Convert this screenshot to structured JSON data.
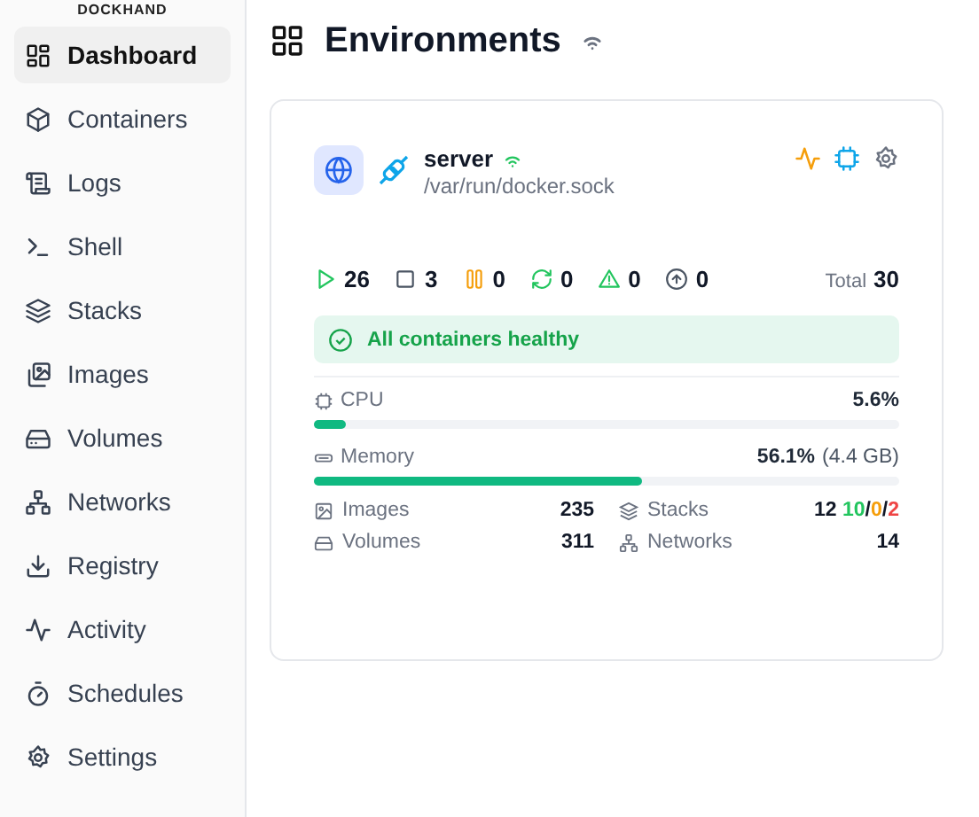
{
  "brand": "DOCKHAND",
  "sidebar": {
    "items": [
      {
        "label": "Dashboard",
        "selected": true
      },
      {
        "label": "Containers",
        "selected": false
      },
      {
        "label": "Logs",
        "selected": false
      },
      {
        "label": "Shell",
        "selected": false
      },
      {
        "label": "Stacks",
        "selected": false
      },
      {
        "label": "Images",
        "selected": false
      },
      {
        "label": "Volumes",
        "selected": false
      },
      {
        "label": "Networks",
        "selected": false
      },
      {
        "label": "Registry",
        "selected": false
      },
      {
        "label": "Activity",
        "selected": false
      },
      {
        "label": "Schedules",
        "selected": false
      },
      {
        "label": "Settings",
        "selected": false
      }
    ]
  },
  "page": {
    "title": "Environments"
  },
  "environment": {
    "name": "server",
    "online": true,
    "socket": "/var/run/docker.sock",
    "counts": [
      {
        "kind": "running",
        "value": "26"
      },
      {
        "kind": "stopped",
        "value": "3"
      },
      {
        "kind": "paused",
        "value": "0"
      },
      {
        "kind": "restarting",
        "value": "0"
      },
      {
        "kind": "unhealthy",
        "value": "0"
      },
      {
        "kind": "pending",
        "value": "0"
      }
    ],
    "total": {
      "label": "Total",
      "value": "30"
    },
    "health": "All containers healthy",
    "metrics": [
      {
        "label": "CPU",
        "reading": "5.6%",
        "level": 0.056
      },
      {
        "label": "Memory",
        "reading": "56.1%",
        "detail": "(4.4 GB)",
        "level": 0.561
      }
    ],
    "resources": [
      {
        "label": "Images",
        "value": "235"
      },
      {
        "label": "Stacks",
        "parts": [
          {
            "text": "12 ",
            "color": "#111827"
          },
          {
            "text": "10",
            "color": "#22c55e"
          },
          {
            "text": "/",
            "color": "#111827"
          },
          {
            "text": "0",
            "color": "#f59e0b"
          },
          {
            "text": "/",
            "color": "#111827"
          },
          {
            "text": "2",
            "color": "#ef4444"
          }
        ]
      },
      {
        "label": "Volumes",
        "value": "311"
      },
      {
        "label": "Networks",
        "value": "14"
      }
    ]
  }
}
